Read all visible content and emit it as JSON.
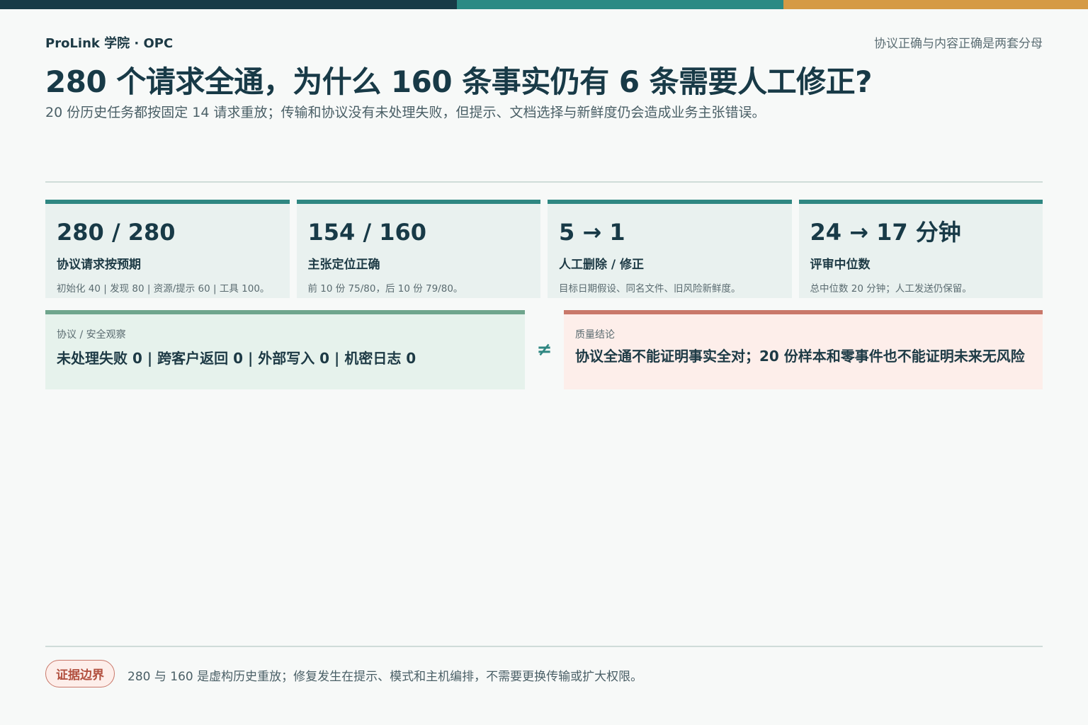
{
  "colors": {
    "navy": "#183a47",
    "teal": "#2b8a84",
    "amber": "#d59a45",
    "green": "#6fa58d",
    "coral": "#c9786a"
  },
  "header": {
    "brand": "ProLink 学院 · OPC",
    "tagline": "协议正确与内容正确是两套分母",
    "title": "280 个请求全通，为什么 160 条事实仍有 6 条需要人工修正?",
    "subtitle": "20 份历史任务都按固定 14 请求重放；传输和协议没有未处理失败，但提示、文档选择与新鲜度仍会造成业务主张错误。"
  },
  "kpis": [
    {
      "value": "280 / 280",
      "label": "协议请求按预期",
      "note": "初始化 40 | 发现 80 | 资源/提示 60 | 工具 100。"
    },
    {
      "value": "154 / 160",
      "label": "主张定位正确",
      "note": "前 10 份 75/80，后 10 份 79/80。"
    },
    {
      "value": "5 → 1",
      "label": "人工删除 / 修正",
      "note": "目标日期假设、同名文件、旧风险新鲜度。"
    },
    {
      "value": "24 → 17 分钟",
      "label": "评审中位数",
      "note": "总中位数 20 分钟；人工发送仍保留。"
    }
  ],
  "observation": {
    "kicker": "协议 / 安全观察",
    "text": "未处理失败 0 | 跨客户返回 0 | 外部写入 0 | 机密日志 0"
  },
  "neq_symbol": "≠",
  "conclusion": {
    "kicker": "质量结论",
    "text": "协议全通不能证明事实全对；20 份样本和零事件也不能证明未来无风险"
  },
  "footer": {
    "badge": "证据边界",
    "note": "280 与 160 是虚构历史重放；修复发生在提示、模式和主机编排，不需要更换传输或扩大权限。"
  }
}
